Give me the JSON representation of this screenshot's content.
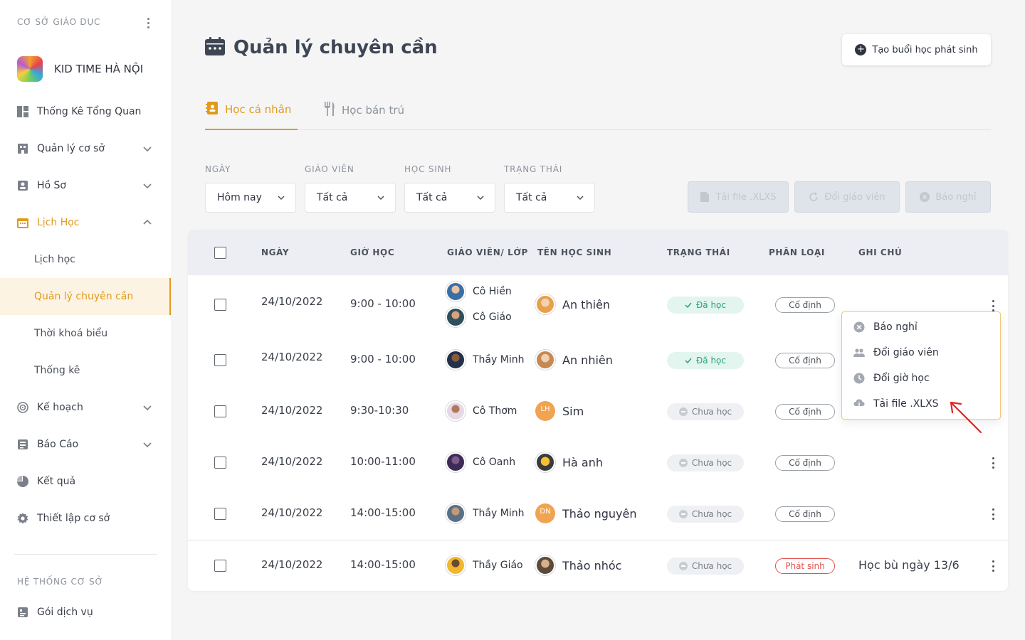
{
  "sidebar": {
    "section_title": "CƠ SỞ GIÁO DỤC",
    "brand_name": "KID TIME HÀ NỘI",
    "items": [
      {
        "label": "Thống Kê Tổng Quan"
      },
      {
        "label": "Quản lý cơ sở"
      },
      {
        "label": "Hồ Sơ"
      },
      {
        "label": "Lịch Học"
      },
      {
        "label": "Kế hoạch"
      },
      {
        "label": "Báo Cáo"
      },
      {
        "label": "Kết quả"
      },
      {
        "label": "Thiết lập cơ sở"
      }
    ],
    "sub_items": [
      {
        "label": "Lịch học"
      },
      {
        "label": "Quản lý chuyên cần"
      },
      {
        "label": "Thời khoá biểu"
      },
      {
        "label": "Thống kê"
      }
    ],
    "footer_title": "HỆ THỐNG CƠ SỞ",
    "footer_item": "Gói dịch vụ"
  },
  "header": {
    "title": "Quản lý chuyên cần",
    "create_button": "Tạo buổi học phát sinh"
  },
  "tabs": [
    {
      "label": "Học cá nhân",
      "active": true
    },
    {
      "label": "Học bán trú",
      "active": false
    }
  ],
  "filters": [
    {
      "label": "NGÀY",
      "value": "Hôm nay"
    },
    {
      "label": "GIÁO VIÊN",
      "value": "Tất cả"
    },
    {
      "label": "HỌC SINH",
      "value": "Tất cả"
    },
    {
      "label": "TRẠNG THÁI",
      "value": "Tất cả"
    }
  ],
  "actions": {
    "download": "Tải file .XLXS",
    "change_teacher": "Đổi giáo viên",
    "report_absence": "Báo nghỉ"
  },
  "table": {
    "headers": [
      "NGÀY",
      "GIỜ HỌC",
      "GIÁO VIÊN/ LỚP",
      "TÊN HỌC SINH",
      "TRẠNG THÁI",
      "PHÂN LOẠI",
      "GHI CHÚ"
    ],
    "rows": [
      {
        "date": "24/10/2022",
        "time": "9:00 - 10:00",
        "teachers": [
          "Cô Hiền",
          "Cô Giáo"
        ],
        "student": "An thiên",
        "status": "Đã học",
        "type": "Cố định",
        "note": ""
      },
      {
        "date": "24/10/2022",
        "time": "9:00 - 10:00",
        "teachers": [
          "Thầy Minh"
        ],
        "student": "An nhiên",
        "status": "Đã học",
        "type": "Cố định",
        "note": ""
      },
      {
        "date": "24/10/2022",
        "time": "9:30-10:30",
        "teachers": [
          "Cô Thơm"
        ],
        "student": "Sim",
        "student_initials": "LH",
        "status": "Chưa học",
        "type": "Cố định",
        "note": ""
      },
      {
        "date": "24/10/2022",
        "time": "10:00-11:00",
        "teachers": [
          "Cô Oanh"
        ],
        "student": "Hà anh",
        "status": "Chưa học",
        "type": "Cố định",
        "note": ""
      },
      {
        "date": "24/10/2022",
        "time": "14:00-15:00",
        "teachers": [
          "Thầy Minh"
        ],
        "student": "Thảo nguyên",
        "student_initials": "DN",
        "status": "Chưa học",
        "type": "Cố định",
        "note": ""
      },
      {
        "date": "24/10/2022",
        "time": "14:00-15:00",
        "teachers": [
          "Thầy Giáo"
        ],
        "student": "Thảo nhóc",
        "status": "Chưa học",
        "type": "Phát sinh",
        "note": "Học bù ngày 13/6"
      }
    ]
  },
  "context_menu": {
    "items": [
      {
        "label": "Báo nghỉ",
        "icon": "close-circle-icon"
      },
      {
        "label": "Đổi giáo viên",
        "icon": "users-icon"
      },
      {
        "label": "Đổi giờ học",
        "icon": "clock-icon"
      },
      {
        "label": "Tải file .XLXS",
        "icon": "cloud-download-icon"
      }
    ]
  },
  "colors": {
    "accent": "#e09a1c",
    "done": "#2da07a",
    "extra": "#e0534f",
    "annotation_arrow": "#e02424"
  }
}
